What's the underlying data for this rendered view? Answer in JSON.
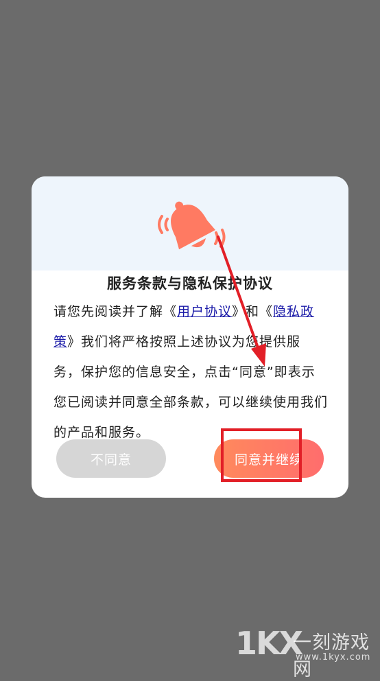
{
  "dialog": {
    "title": "服务条款与隐私保护协议",
    "body": {
      "part1": "请您先阅读并了解《",
      "link_user_agreement": "用户协议",
      "part2": "》和《",
      "link_privacy_policy": "隐私政策",
      "part3": "》我们将严格按照上述协议为您提供服务，保护您的信息安全，点击“同意”即表示您已阅读并同意全部条款，可以继续使用我们的产品和服务。"
    },
    "buttons": {
      "disagree": "不同意",
      "agree": "同意并继续"
    }
  },
  "watermark": {
    "logo": "1KX",
    "name": "一刻游戏网",
    "url": "www.1kyx.com"
  },
  "colors": {
    "overlay": "#6b6b6b",
    "bell": "#ff7a62",
    "link": "#1a1aa8",
    "annotation": "#e21f27",
    "agree_gradient_start": "#ff8a5c",
    "agree_gradient_end": "#ff6d6d"
  }
}
